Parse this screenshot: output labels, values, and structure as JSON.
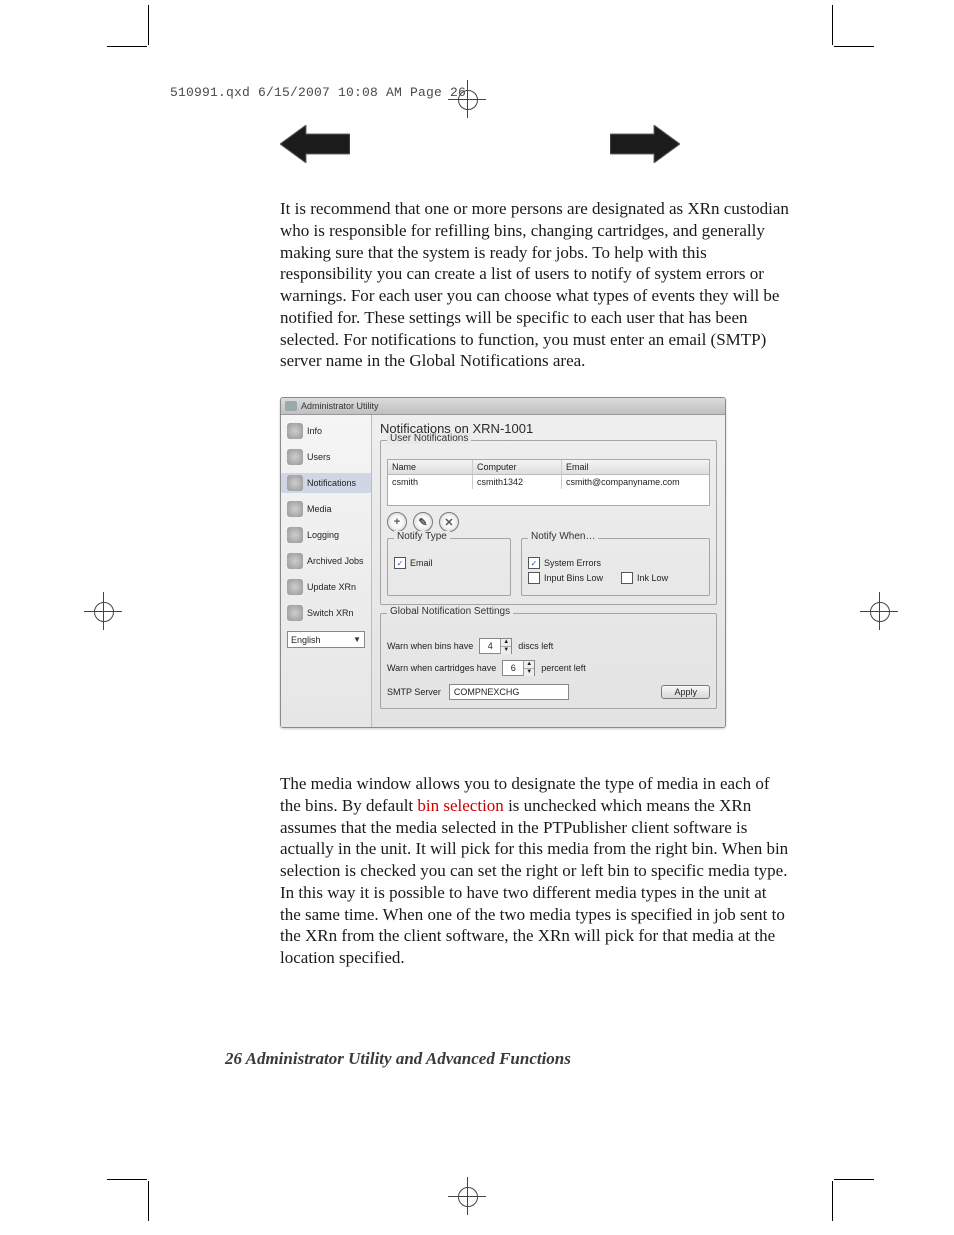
{
  "doc_header": "510991.qxd  6/15/2007  10:08 AM  Page 26",
  "para1": "It is recommend that one or more persons are designated as XRn custodian who is responsible for refilling bins, changing cartridges, and generally making sure that the system is ready for jobs. To help with this responsibility you can create a list of users to notify of system errors or warnings.  For each user you can choose what types of events they will be notified for. These settings will be specific to each user that has been selected.  For notifications to function, you must enter an email (SMTP) server name in the Global Notifications area.",
  "para2_a": "The media window allows you to designate the type of media in each of the bins.  By default ",
  "para2_red": "bin selection",
  "para2_b": " is unchecked which means the XRn assumes that the media selected in the PTPublisher client software is actually in the unit.  It will pick for this media from the right bin. When bin selection is checked you can set the right or left bin to specific media type. In this way it is possible to have two different media types in the unit at the same time. When one of the two media types is specified in job sent to the XRn from the client software, the XRn will pick for that media at the location specified.",
  "footer_page": "26",
  "footer_title": " Administrator Utility and Advanced Functions",
  "app": {
    "title": "Administrator Utility",
    "sidebar": {
      "items": [
        {
          "label": "Info"
        },
        {
          "label": "Users"
        },
        {
          "label": "Notifications"
        },
        {
          "label": "Media"
        },
        {
          "label": "Logging"
        },
        {
          "label": "Archived Jobs"
        },
        {
          "label": "Update XRn"
        },
        {
          "label": "Switch XRn"
        }
      ],
      "language": "English"
    },
    "content": {
      "heading": "Notifications on XRN-1001",
      "user_notifications": {
        "legend": "User Notifications",
        "cols": {
          "name": "Name",
          "computer": "Computer",
          "email": "Email"
        },
        "row": {
          "name": "csmith",
          "computer": "csmith1342",
          "email": "csmith@companyname.com"
        }
      },
      "iconbar": {
        "add": "+",
        "edit": "✎",
        "del": "✕"
      },
      "notify_type": {
        "legend": "Notify Type",
        "email": "Email"
      },
      "notify_when": {
        "legend": "Notify When…",
        "sys_err": "System Errors",
        "bins_low": "Input Bins Low",
        "ink_low": "Ink Low"
      },
      "global": {
        "legend": "Global Notification Settings",
        "bins_a": "Warn when bins have",
        "bins_val": "4",
        "bins_b": "discs left",
        "cart_a": "Warn when cartridges have",
        "cart_val": "6",
        "cart_b": "percent left",
        "smtp_label": "SMTP Server",
        "smtp_value": "COMPNEXCHG",
        "apply": "Apply"
      }
    }
  }
}
